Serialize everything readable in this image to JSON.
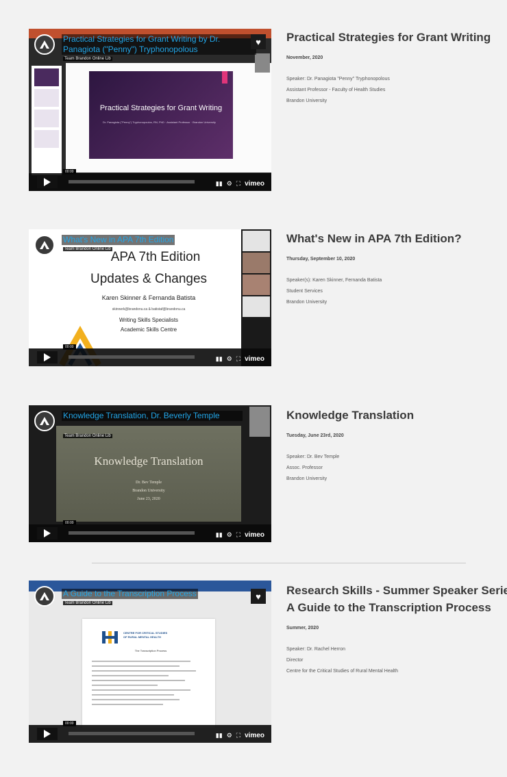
{
  "videos": [
    {
      "video_title": "Practical Strategies for Grant Writing by Dr. Panagiota (\"Penny\") Tryphonopolous",
      "team_label": "Team Brandon Online Lib",
      "slide_title": "Practical Strategies for Grant Writing",
      "slide_subtitle": "Dr. Panagiota (\"Penny\") Tryphonopoulos, RN, PhD · Assistant Professor · Brandon University",
      "time_badge": "00:00",
      "title": "Practical Strategies for Grant Writing",
      "date": "November, 2020",
      "details": [
        "Speaker: Dr. Panagiota \"Penny\" Tryphonopolous",
        "Assistant Professor - Faculty of Health Studies",
        "Brandon University"
      ]
    },
    {
      "video_title": "What's New in APA 7th Edition",
      "team_label": "Team Brandon Online Lib",
      "slide_lines": [
        "APA 7th Edition",
        "Updates & Changes",
        "Karen Skinner & Fernanda Batista",
        "skinnerk@brandonu.ca  &  batistaf@brandonu.ca",
        "Writing Skills Specialists",
        "Academic Skills Centre"
      ],
      "time_badge": "00:00",
      "title": "What's New in APA 7th Edition?",
      "date": "Thursday, September 10, 2020",
      "details": [
        "Speaker(s): Karen Skinner, Fernanda Batista",
        "Student Services",
        "Brandon University"
      ]
    },
    {
      "video_title": "Knowledge Translation, Dr. Beverly Temple",
      "team_label": "Team Brandon Online Lib",
      "slide_title": "Knowledge Translation",
      "slide_lines": [
        "Dr. Bev Temple",
        "Brandon University",
        "June 23, 2020"
      ],
      "time_badge": "00:00",
      "title": "Knowledge Translation",
      "date": "Tuesday, June 23rd, 2020",
      "details": [
        "Speaker: Dr. Bev Temple",
        "Assoc. Professor",
        "Brandon University"
      ]
    },
    {
      "video_title": "A Guide to the Transcription Process",
      "team_label": "Team Brandon Online Lib",
      "doc_heading": "CENTRE FOR CRITICAL STUDIES OF RURAL MENTAL HEALTH",
      "doc_subheading": "The Transcription Process",
      "time_badge": "00:00",
      "title_line1": "Research Skills - Summer Speaker Series:",
      "title_line2": "A Guide to the Transcription Process",
      "date": "Summer, 2020",
      "details": [
        "Speaker: Dr. Rachel Herron",
        "Director",
        "Centre for the Critical Studies of Rural Mental Health"
      ]
    }
  ],
  "player": {
    "brand": "vimeo",
    "icons": [
      "play-icon",
      "volume-icon",
      "settings-icon",
      "fullscreen-icon",
      "heart-icon"
    ]
  },
  "colors": {
    "video_title": "#22a6e8",
    "page_bg": "#f2f2f2",
    "slide_purple": "#4a2a5e"
  }
}
